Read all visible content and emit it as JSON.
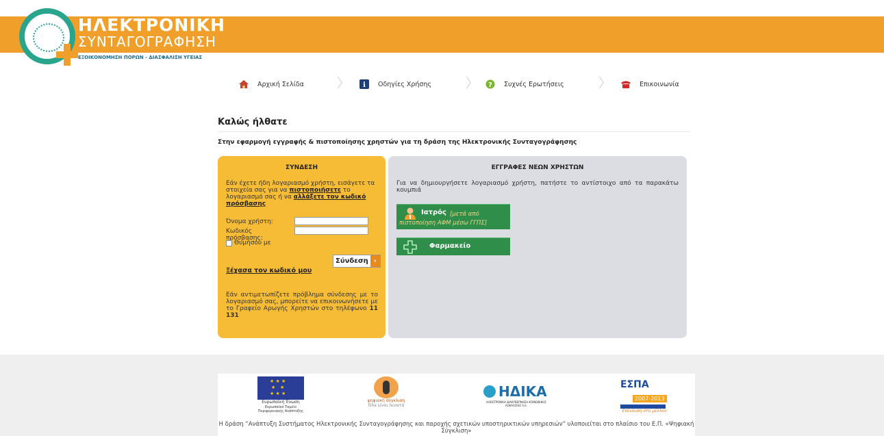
{
  "header": {
    "logo_title_line1": "ΗΛΕΚΤΡΟΝΙΚΗ",
    "logo_title_line2": "ΣΥΝΤΑΓΟΓΡΑΦΗΣΗ",
    "logo_tagline": "ΕΞΟΙΚΟΝΟΜΗΣΗ ΠΟΡΩΝ - ΔΙΑΣΦΑΛΙΣΗ ΥΓΕΙΑΣ"
  },
  "nav": {
    "items": [
      {
        "label": "Αρχική Σελίδα",
        "icon": "home-icon"
      },
      {
        "label": "Οδηγίες Χρήσης",
        "icon": "info-icon"
      },
      {
        "label": "Συχνές Ερωτήσεις",
        "icon": "help-icon"
      },
      {
        "label": "Επικοινωνία",
        "icon": "phone-icon"
      }
    ]
  },
  "main": {
    "welcome": "Καλώς ήλθατε",
    "subtitle": "Στην εφαρμογή εγγραφής & πιστοποίησης χρηστών για τη δράση της Ηλεκτρονικής Συνταγογράφησης"
  },
  "login": {
    "heading": "ΣΥΝΔΕΣΗ",
    "intro_text": "Εάν έχετε ήδη λογαριασμό χρήστη, εισάγετε τα στοιχεία σας για να",
    "certify_link": "πιστοποιήσετε",
    "intro_mid": "το λογαριασμό σας ή να",
    "change_pw_link": "αλλάξετε τον κωδικό πρόσβασης",
    "username_label": "Όνομα χρήστη:",
    "password_label": "Κωδικός πρόσβασης:",
    "username_value": "",
    "password_value": "",
    "remember_label": "Θυμήσου με",
    "login_button": "Σύνδεση",
    "forgot_link": "Ξέχασα τον κωδικό μου",
    "trouble_text": "Εάν αντιμετωπίζετε πρόβλημα σύνδεσης με το λογαριασμό σας, μπορείτε να επικοινωνήσετε με το Γραφείο Αρωγής Χρηστών στο τηλέφωνο",
    "phone": "11 131"
  },
  "register": {
    "heading": "ΕΓΓΡΑΦΕΣ ΝΕΩΝ ΧΡΗΣΤΩΝ",
    "description": "Για να δημιουργήσετε λογαριασμό χρήστη, πατήστε το αντίστοιχο από τα παρακάτω κουμπιά",
    "doctor_label": "Ιατρός",
    "doctor_note": "[μετά από πιστοποίηση ΑΦΜ μέσω ΓΓΠΣ]",
    "pharmacy_label": "Φαρμακείο"
  },
  "footer": {
    "eu_caption": "Ευρωπαϊκή Ένωση",
    "eu_sub": "Ευρωπαϊκό Ταμείο Περιφερειακής Ανάπτυξης",
    "ds_caption": "ψηφιακή σύγκλιση",
    "ds_sub": "Όλα είναι δυνατά",
    "idika_brand": "ΗΔΙΚΑ",
    "idika_sub": "ΗΛΕΚΤΡΟΝΙΚΗ ΔΙΑΚΥΒΕΡΝΗΣΗ ΚΟΙΝΩΝΙΚΗΣ ΑΣΦΑΛΙΣΗΣ Α.Ε.",
    "espa_brand": "ΕΣΠΑ",
    "espa_years": "2007-2013",
    "espa_sub": "Επένδυση στο μέλλον",
    "note": "Η δράση “Ανάπτυξη Συστήματος Ηλεκτρονικής Συνταγογράφησης και παροχής σχετικών υποστηρικτικών υπηρεσιών” υλοποιείται στο πλαίσιο του Ε.Π. «Ψηφιακή Σύγκλιση»"
  },
  "colors": {
    "banner": "#f0a02a",
    "login_panel": "#f6bc35",
    "register_panel": "#dcdce3",
    "register_button": "#2f8f4a",
    "logo_teal": "#2aa58d"
  }
}
